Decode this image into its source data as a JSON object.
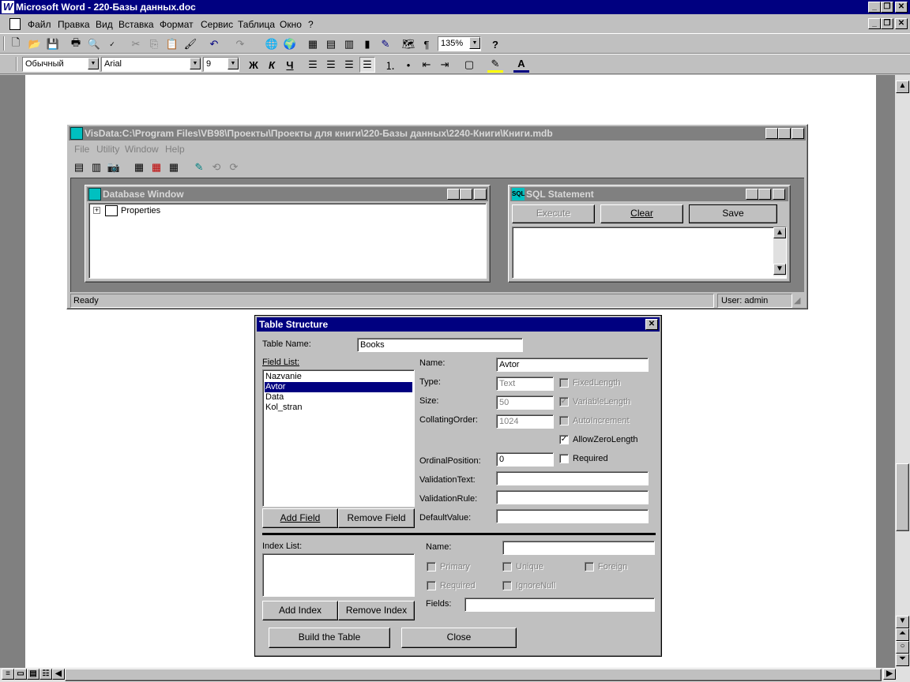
{
  "word": {
    "title": "Microsoft Word - 220-Базы данных.doc",
    "menu": [
      "Файл",
      "Правка",
      "Вид",
      "Вставка",
      "Формат",
      "Сервис",
      "Таблица",
      "Окно",
      "?"
    ],
    "zoom": "135%",
    "style": "Обычный",
    "font": "Arial",
    "size": "9",
    "format_buttons": [
      "Ж",
      "К",
      "Ч"
    ]
  },
  "visdata": {
    "title": "VisData:C:\\Program Files\\VB98\\Проекты\\Проекты для книги\\220-Базы данных\\2240-Книги\\Книги.mdb",
    "menu": [
      "File",
      "Utility",
      "Window",
      "Help"
    ],
    "status": "Ready",
    "user": "User: admin",
    "db_window": {
      "title": "Database Window",
      "tree_item": "Properties"
    },
    "sql": {
      "title": "SQL Statement",
      "execute": "Execute",
      "clear": "Clear",
      "save": "Save"
    }
  },
  "table_structure": {
    "title": "Table Structure",
    "table_name_label": "Table Name:",
    "table_name": "Books",
    "field_list_label": "Field List:",
    "fields": [
      "Nazvanie",
      "Avtor",
      "Data",
      "Kol_stran"
    ],
    "selected_field": "Avtor",
    "name_label": "Name:",
    "name_value": "Avtor",
    "type_label": "Type:",
    "type_value": "Text",
    "size_label": "Size:",
    "size_value": "50",
    "collating_label": "CollatingOrder:",
    "collating_value": "1024",
    "ordinal_label": "OrdinalPosition:",
    "ordinal_value": "0",
    "validation_text_label": "ValidationText:",
    "validation_rule_label": "ValidationRule:",
    "default_value_label": "DefaultValue:",
    "fixed_length": "FixedLength",
    "variable_length": "VariableLength",
    "auto_increment": "AutoIncrement",
    "allow_zero_length": "AllowZeroLength",
    "required": "Required",
    "add_field": "Add Field",
    "remove_field": "Remove Field",
    "index_list_label": "Index List:",
    "index_name_label": "Name:",
    "primary": "Primary",
    "unique": "Unique",
    "foreign": "Foreign",
    "index_required": "Required",
    "ignore_null": "IgnoreNull",
    "fields_label": "Fields:",
    "add_index": "Add Index",
    "remove_index": "Remove Index",
    "build_table": "Build the Table",
    "close": "Close"
  }
}
